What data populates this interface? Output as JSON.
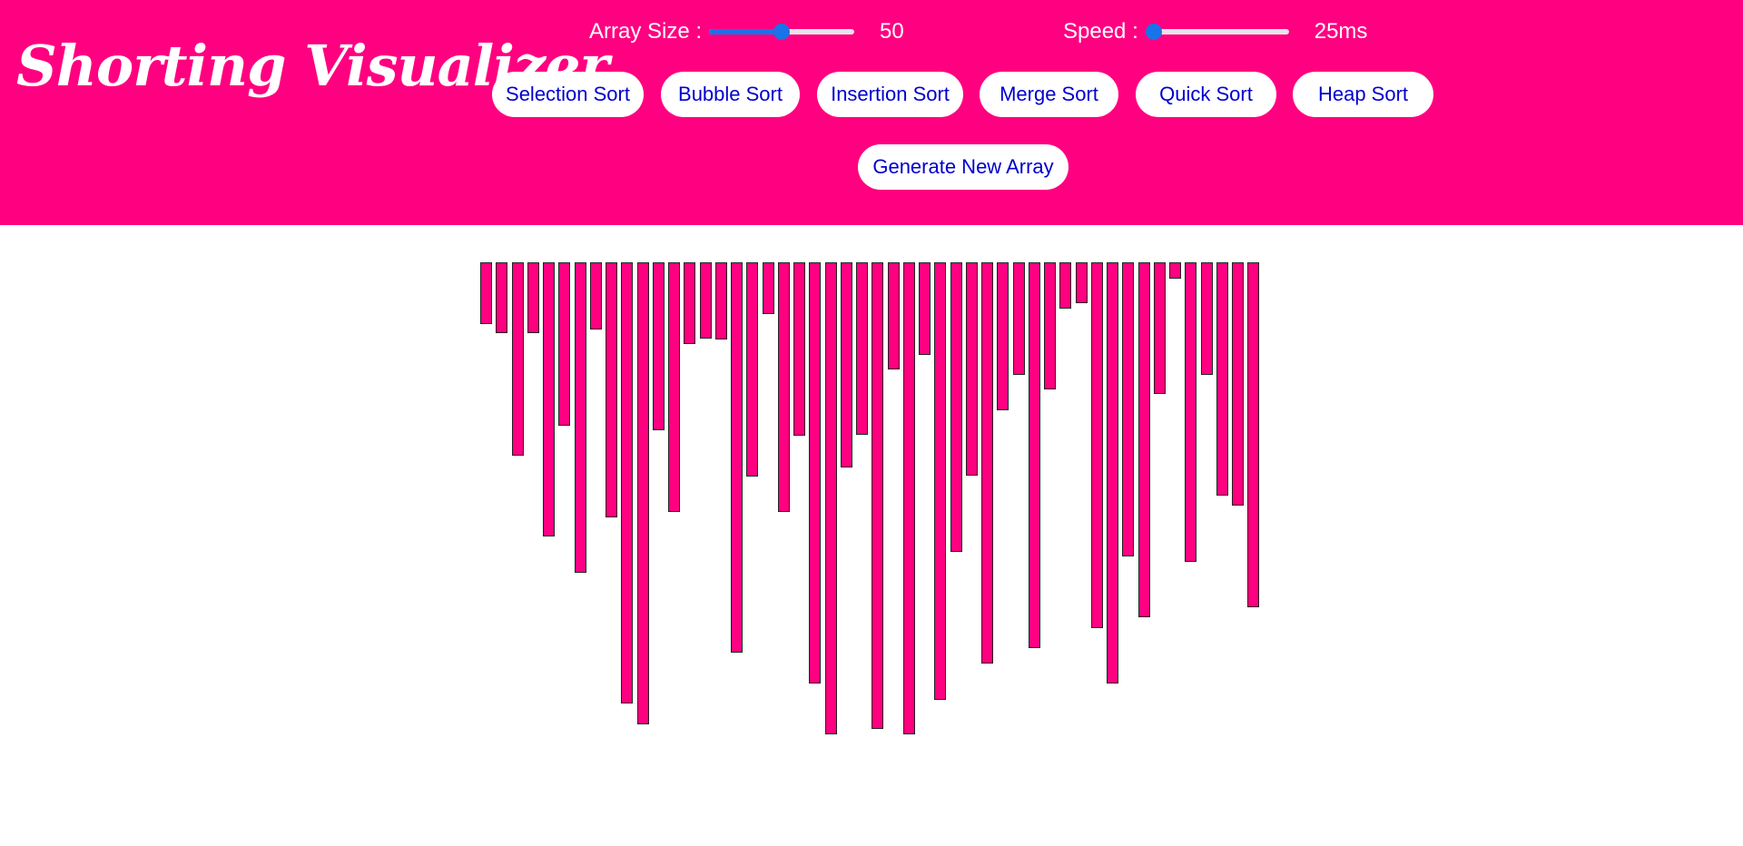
{
  "app": {
    "title": "Shorting Visualizer"
  },
  "controls": {
    "array_size": {
      "label": "Array Size :",
      "value": "50",
      "fraction": 0.5
    },
    "speed": {
      "label": "Speed :",
      "value": "25ms",
      "fraction": 0.0
    }
  },
  "buttons": {
    "selection_sort": "Selection Sort",
    "bubble_sort": "Bubble Sort",
    "insertion_sort": "Insertion Sort",
    "merge_sort": "Merge Sort",
    "quick_sort": "Quick Sort",
    "heap_sort": "Heap Sort",
    "generate_new_array": "Generate New Array"
  },
  "colors": {
    "accent": "#ff0080",
    "button_text": "#0000cd",
    "slider": "#1a73e8"
  },
  "array": {
    "values": [
      68,
      78,
      213,
      78,
      302,
      180,
      342,
      74,
      281,
      486,
      509,
      185,
      275,
      90,
      84,
      85,
      430,
      236,
      57,
      275,
      191,
      464,
      520,
      226,
      190,
      514,
      118,
      520,
      102,
      482,
      319,
      235,
      442,
      163,
      124,
      425,
      140,
      51,
      45,
      403,
      464,
      324,
      391,
      145,
      18,
      330,
      124,
      257,
      268,
      380
    ]
  }
}
